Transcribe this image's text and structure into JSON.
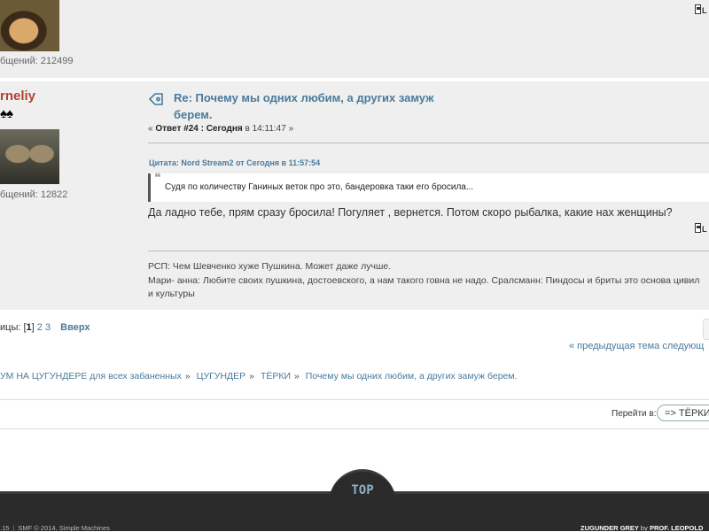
{
  "prev_post": {
    "post_count": "бщений: 212499"
  },
  "post": {
    "poster_name": "rneliy",
    "rank_stars": "♠♠",
    "post_count": "бщений: 12822",
    "subject": "Re: Почему мы одних любим, а других замуж берем.",
    "reply_prefix": "« ",
    "reply_label": "Ответ #24 : Сегодня",
    "reply_time": " в 14:11:47 »",
    "quote_header": "Цитата: Nord Stream2 от Сегодня в 11:57:54",
    "quote_text": "Судя по количеству Ганиных веток про это, бандеровка таки его бросила...",
    "body": "Да ладно тебе, прям сразу бросила! Погуляет , вернется. Потом скоро рыбалка, какие нах женщины?",
    "signature_lines": [
      "РСП: Чем Шевченко хуже Пушкина. Может даже лучше.",
      "Мари- анна: Любите своих пушкина, достоевского, а нам такого говна не надо. Сралсманн: Пиндосы и бриты это основа цивил",
      "и культуры"
    ]
  },
  "pagination": {
    "prefix": "ицы: [",
    "current": "1",
    "suffix": "]",
    "page2": "2",
    "page3": "3",
    "up": "Вверх"
  },
  "topic_nav": {
    "prev_next": "« предыдущая тема следующ"
  },
  "breadcrumb": {
    "items": [
      "УМ НА ЦУГУНДЕРЕ для всех забаненных",
      "ЦУГУНДЕР",
      "ТЁРКИ",
      "Почему мы одних любим, а других замуж берем."
    ],
    "separator": "»"
  },
  "jump": {
    "label": "Перейти в:",
    "value": "=> ТЁРКИ"
  },
  "footer": {
    "top_label": "TOP",
    "version": ".15",
    "copyright": "SMF © 2014",
    "sm_link": "Simple Machines",
    "theme_name": "ZUGUNDER GREY",
    "by": " by ",
    "author": "PROF. LEOPOLD"
  },
  "colors": {
    "link": "#4a7a9c",
    "poster_name": "#b0442c",
    "post_bg": "#efefef",
    "footer_bg": "#2b2b2b"
  },
  "progress": 0.4,
  "icons": [
    "topic-icon",
    "report-icon",
    "quote-icon"
  ]
}
